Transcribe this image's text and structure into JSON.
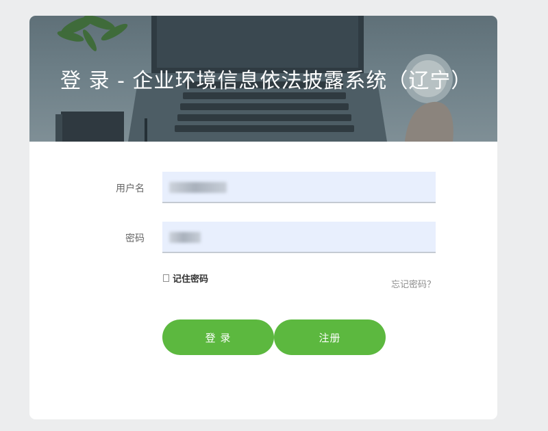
{
  "banner": {
    "title": "登 录 - 企业环境信息依法披露系统（辽宁）"
  },
  "form": {
    "username_label": "用户名",
    "password_label": "密码",
    "remember_label": "记住密码",
    "forgot_label": "忘记密码？"
  },
  "actions": {
    "login_label": "登 录",
    "register_label": "注册"
  },
  "colors": {
    "accent": "#5cb83f",
    "input_bg": "#e8effd",
    "page_bg": "#ecedee"
  }
}
